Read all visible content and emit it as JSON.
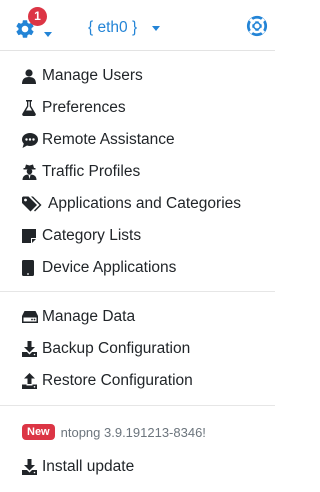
{
  "toolbar": {
    "notification_count": "1",
    "interface_label": "{ eth0 }"
  },
  "colors": {
    "accent": "#2384d6",
    "badge": "#dc3545",
    "text": "#212529",
    "muted": "#6c757d"
  },
  "menu": {
    "section1": [
      {
        "label": "Manage Users",
        "icon": "user-icon"
      },
      {
        "label": "Preferences",
        "icon": "flask-icon"
      },
      {
        "label": "Remote Assistance",
        "icon": "comment-dots-icon"
      },
      {
        "label": "Traffic Profiles",
        "icon": "user-secret-icon"
      },
      {
        "label": "Applications and Categories",
        "icon": "tags-icon"
      },
      {
        "label": "Category Lists",
        "icon": "sticky-note-icon"
      },
      {
        "label": "Device Applications",
        "icon": "tablet-icon"
      }
    ],
    "section2": [
      {
        "label": "Manage Data",
        "icon": "hdd-icon"
      },
      {
        "label": "Backup Configuration",
        "icon": "download-icon"
      },
      {
        "label": "Restore Configuration",
        "icon": "upload-icon"
      }
    ],
    "update": {
      "badge": "New",
      "version_text": "ntopng 3.9.191213-8346!",
      "install_label": "Install update",
      "install_icon": "download-icon"
    }
  }
}
